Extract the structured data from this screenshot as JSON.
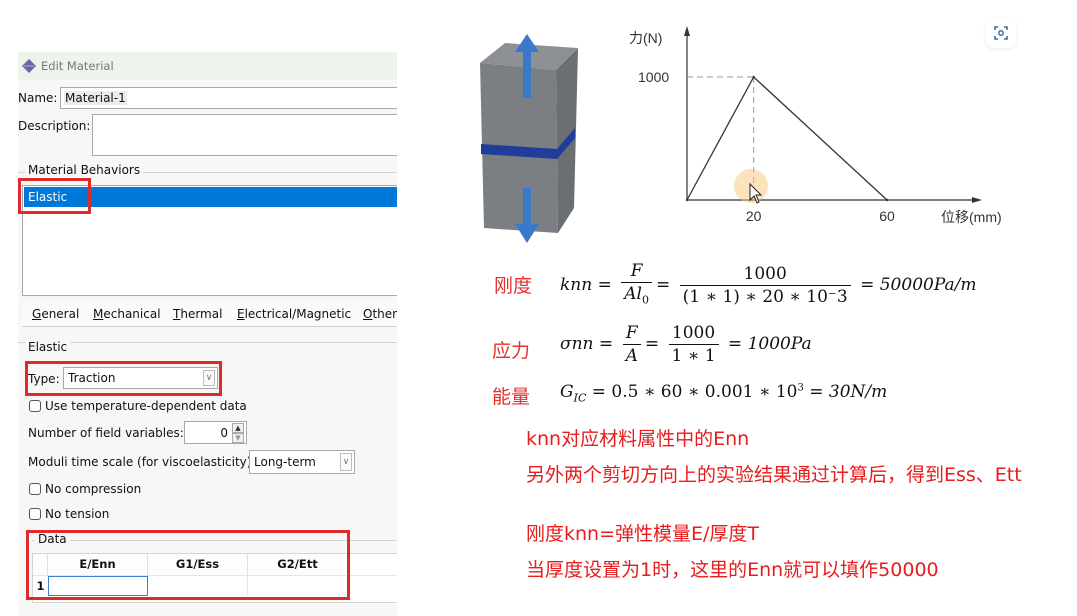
{
  "dialog": {
    "title": "Edit Material",
    "name_label": "Name:",
    "name_value": "Material-1",
    "description_label": "Description:",
    "description_value": "",
    "behaviors_group": "Material Behaviors",
    "behaviors": [
      "Elastic"
    ],
    "selected_behavior": "Elastic",
    "menu": [
      {
        "label": "General",
        "mnemonic": "G",
        "rest": "eneral"
      },
      {
        "label": "Mechanical",
        "mnemonic": "M",
        "rest": "echanical"
      },
      {
        "label": "Thermal",
        "mnemonic": "T",
        "rest": "hermal"
      },
      {
        "label": "Electrical/Magnetic",
        "mnemonic": "E",
        "rest": "lectrical/Magnetic"
      },
      {
        "label": "Other",
        "mnemonic": "O",
        "rest": "ther"
      }
    ],
    "elastic_group": "Elastic",
    "type_label": "Type:",
    "type_value": "Traction",
    "use_temp_label": "Use temperature-dependent data",
    "use_temp_checked": false,
    "field_vars_label": "Number of field variables:",
    "field_vars_value": "0",
    "moduli_label": "Moduli time scale (for viscoelasticity):",
    "moduli_value": "Long-term",
    "no_compression_label": "No compression",
    "no_compression_checked": false,
    "no_tension_label": "No tension",
    "no_tension_checked": false,
    "data_group": "Data",
    "table": {
      "columns": [
        "E/Enn",
        "G1/Ess",
        "G2/Ett"
      ],
      "rows": [
        {
          "index": "1",
          "cells": [
            "",
            "",
            ""
          ]
        }
      ]
    }
  },
  "chart_data": {
    "type": "line",
    "title": "",
    "ylabel": "力(N)",
    "xlabel": "位移(mm)",
    "x": [
      0,
      20,
      60
    ],
    "values": [
      0,
      1000,
      0
    ],
    "xticks": [
      "20",
      "60"
    ],
    "yticks": [
      "1000"
    ],
    "xlim": [
      0,
      73
    ],
    "ylim": [
      0,
      1250
    ],
    "grid": false,
    "guides": "dashed lines from peak (20, 1000) to both axes"
  },
  "formulas": [
    {
      "label": "刚度",
      "lhs": "knn",
      "frac1": {
        "num": "F",
        "den": "Al",
        "den_sub": "0"
      },
      "frac2": {
        "num": "1000",
        "den": "(1 ∗ 1) ∗ 20 ∗ 10⁻3"
      },
      "result": "= 50000Pa/m"
    },
    {
      "label": "应力",
      "lhs": "σnn",
      "frac1": {
        "num": "F",
        "den": "A"
      },
      "frac2": {
        "num": "1000",
        "den": "1 ∗ 1"
      },
      "result": "= 1000Pa"
    },
    {
      "label": "能量",
      "lhs_main": "G",
      "lhs_sub": "IC",
      "expr": "= 0.5 ∗ 60 ∗ 0.001 ∗ 10",
      "expr_sup": "3",
      "result": "= 30N/m"
    }
  ],
  "notes": [
    "knn对应材料属性中的Enn",
    "另外两个剪切方向上的实验结果通过计算后，得到Ess、Ett",
    "刚度knn=弹性模量E/厚度T",
    "当厚度设置为1时，这里的Enn就可以填作50000"
  ],
  "colors": {
    "highlight_red": "#e02a2a",
    "selection_blue": "#0078d7",
    "note_red": "#e81c1c",
    "arrow_blue": "#3a78c9",
    "band_blue": "#1f3d9a"
  }
}
